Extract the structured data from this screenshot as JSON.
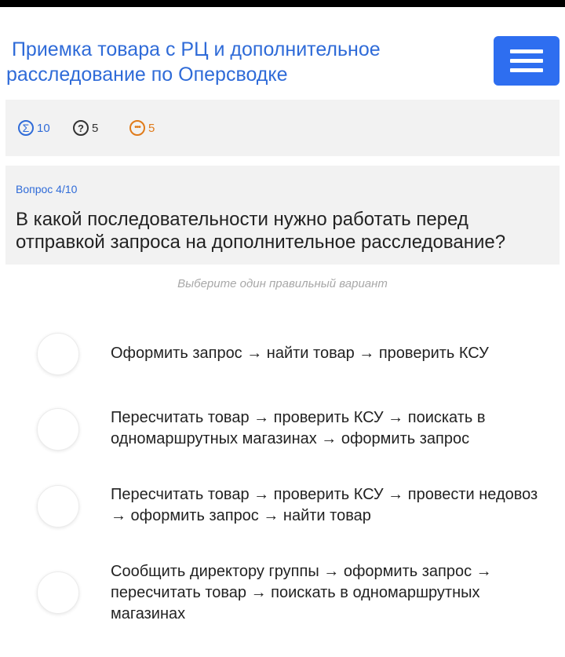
{
  "header": {
    "title": " Приемка товара с РЦ и дополнительное\nрасследование по Оперсводке",
    "menu_icon": "hamburger-menu-icon"
  },
  "stats": {
    "total": {
      "icon": "sigma-icon",
      "symbol": "Σ",
      "value": "10"
    },
    "unknown": {
      "icon": "question-icon",
      "symbol": "?",
      "value": "5"
    },
    "more": {
      "icon": "ellipsis-icon",
      "symbol": "•••",
      "value": "5"
    }
  },
  "question": {
    "number_label": "Вопрос 4/10",
    "text": "В какой последовательности нужно работать перед отправкой запроса на дополнительное расследование?"
  },
  "hint": "Выберите один правильный вариант",
  "options": [
    {
      "label": "Оформить запрос → найти товар → проверить КСУ"
    },
    {
      "label": "Пересчитать товар → проверить КСУ → поискать в одномаршрутных магазинах → оформить запрос"
    },
    {
      "label": "Пересчитать товар → проверить КСУ → провести недовоз → оформить запрос → найти товар"
    },
    {
      "label": "Сообщить директору группы → оформить запрос → пересчитать товар → поискать в одномаршрутных магазинах"
    }
  ],
  "colors": {
    "accent": "#2f6bd8",
    "menu_button": "#2e6ef0",
    "panel_bg": "#f2f2f2",
    "more_orange": "#e07b1a"
  }
}
